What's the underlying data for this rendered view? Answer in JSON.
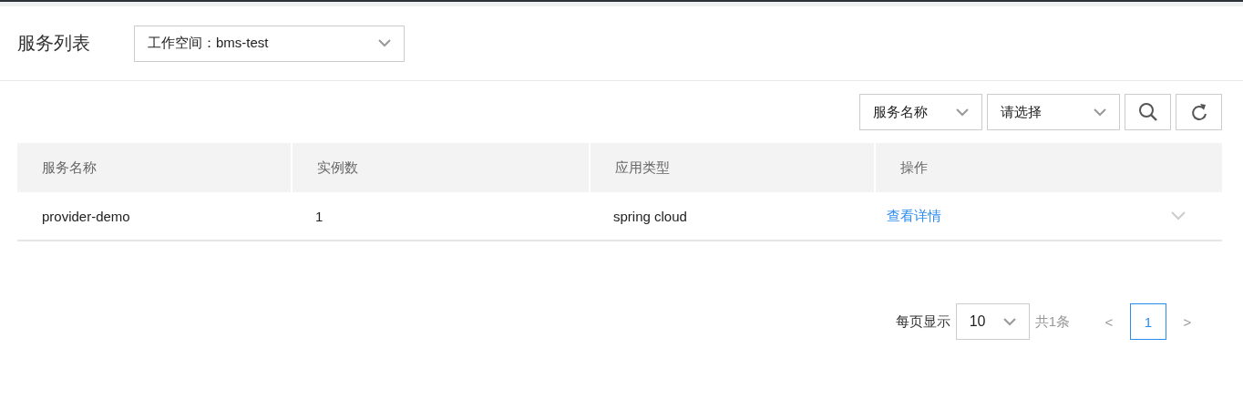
{
  "header": {
    "title": "服务列表",
    "workspace_select": {
      "label": "工作空间：",
      "value": "bms-test"
    }
  },
  "toolbar": {
    "field_select": "服务名称",
    "value_select": {
      "placeholder": "请选择"
    }
  },
  "table": {
    "columns": [
      "服务名称",
      "实例数",
      "应用类型",
      "操作"
    ],
    "rows": [
      {
        "cells": [
          "provider-demo",
          "1",
          "spring cloud"
        ],
        "action": "查看详情",
        "expanded": false
      }
    ]
  },
  "pagination": {
    "page_size_label": "每页显示",
    "page_size": "10",
    "total": "共1条",
    "prev": "<",
    "next": ">",
    "pages": [
      {
        "label": "1",
        "selected": true
      }
    ]
  }
}
